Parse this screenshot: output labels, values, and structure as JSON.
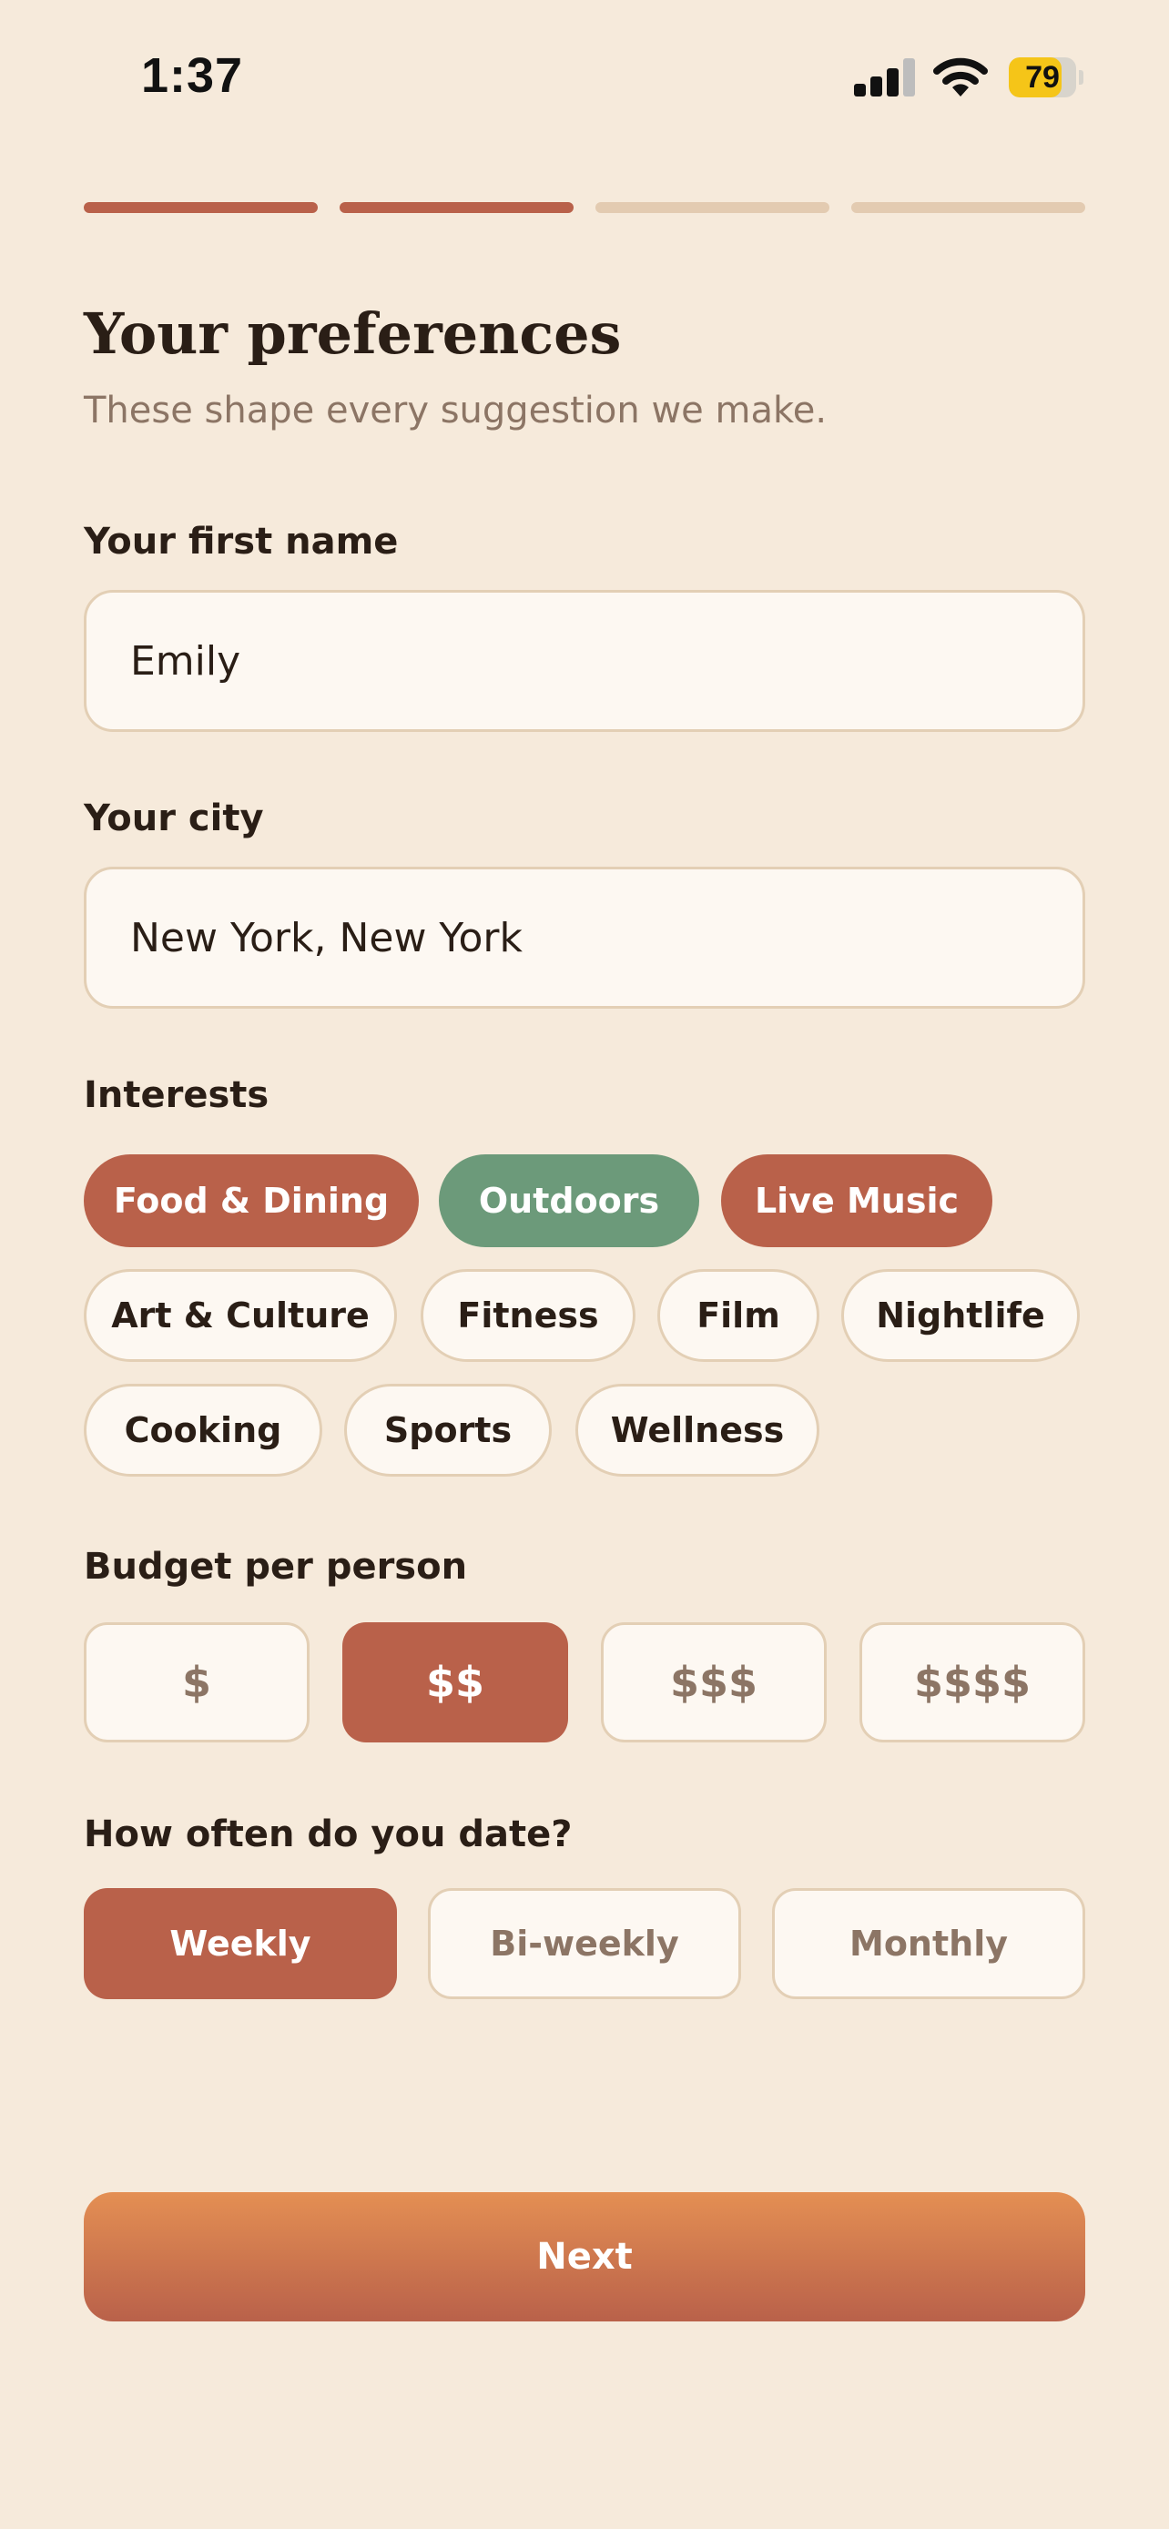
{
  "status_bar": {
    "time": "1:37",
    "battery": "79",
    "battery_level": 0.79,
    "icons": [
      "signal-icon",
      "wifi-icon",
      "battery-icon"
    ]
  },
  "progress": {
    "total_steps": 4,
    "completed_steps": 2
  },
  "header": {
    "title": "Your preferences",
    "subtitle": "These shape every suggestion we make."
  },
  "form": {
    "name": {
      "label": "Your first name",
      "value": "Emily"
    },
    "city": {
      "label": "Your city",
      "value": "New York, New York"
    },
    "interests": {
      "label": "Interests",
      "options": [
        {
          "label": "Food & Dining",
          "selected": true,
          "color": "#B9614A"
        },
        {
          "label": "Outdoors",
          "selected": true,
          "color": "#6C9A7A"
        },
        {
          "label": "Live Music",
          "selected": true,
          "color": "#B9614A"
        },
        {
          "label": "Art & Culture",
          "selected": false
        },
        {
          "label": "Fitness",
          "selected": false
        },
        {
          "label": "Film",
          "selected": false
        },
        {
          "label": "Nightlife",
          "selected": false
        },
        {
          "label": "Cooking",
          "selected": false
        },
        {
          "label": "Sports",
          "selected": false
        },
        {
          "label": "Wellness",
          "selected": false
        }
      ]
    },
    "budget": {
      "label": "Budget per person",
      "options": [
        {
          "label": "$",
          "selected": false
        },
        {
          "label": "$$",
          "selected": true
        },
        {
          "label": "$$$",
          "selected": false
        },
        {
          "label": "$$$$",
          "selected": false
        }
      ]
    },
    "frequency": {
      "label": "How often do you date?",
      "options": [
        {
          "label": "Weekly",
          "selected": true
        },
        {
          "label": "Bi-weekly",
          "selected": false
        },
        {
          "label": "Monthly",
          "selected": false
        }
      ]
    }
  },
  "footer": {
    "next_label": "Next"
  },
  "colors": {
    "background": "#F6EADB",
    "accent": "#B9614A",
    "accent_green": "#6C9A7A",
    "cta_gradient_top": "#E48F53",
    "cta_gradient_bottom": "#B9614A"
  }
}
